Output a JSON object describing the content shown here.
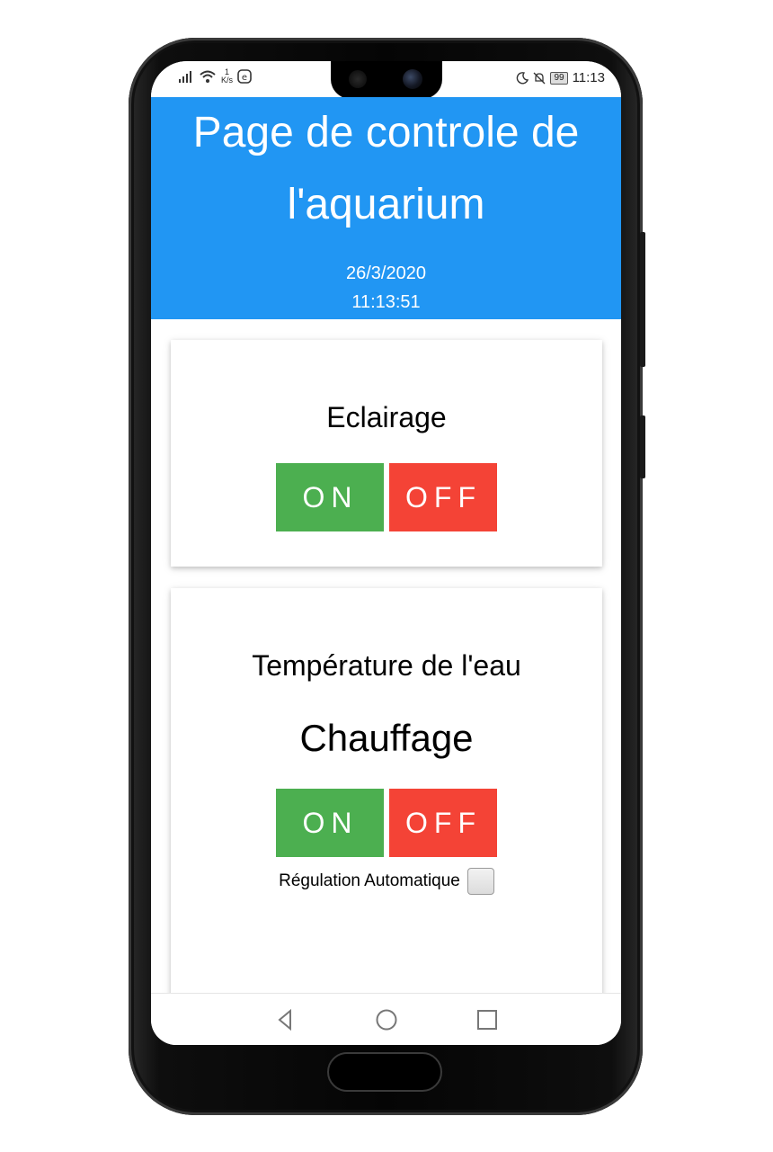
{
  "status_bar": {
    "speed_value": "1",
    "speed_unit": "K/s",
    "battery": "99",
    "clock": "11:13"
  },
  "header": {
    "title": "Page de controle de l'aquarium",
    "date": "26/3/2020",
    "time": "11:13:51"
  },
  "lighting": {
    "title": "Eclairage",
    "on_label": "ON",
    "off_label": "OFF"
  },
  "water": {
    "title": "Température de l'eau",
    "heating_title": "Chauffage",
    "on_label": "ON",
    "off_label": "OFF",
    "auto_regulation_label": "Régulation Automatique",
    "auto_regulation_checked": false
  },
  "colors": {
    "header_bg": "#2196F3",
    "on_button": "#4CAF50",
    "off_button": "#f44336"
  }
}
